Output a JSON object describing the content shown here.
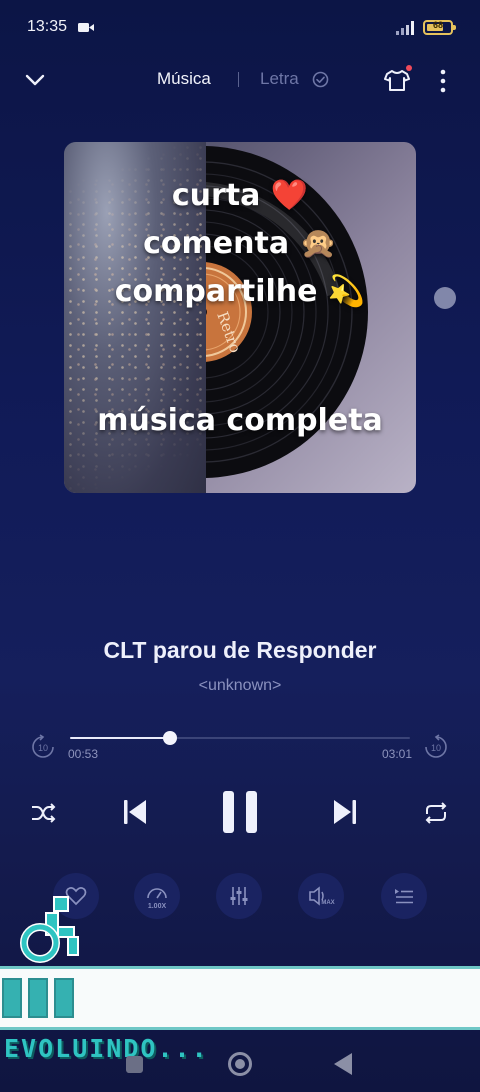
{
  "status_bar": {
    "time": "13:35",
    "battery": "68"
  },
  "nav": {
    "tab_music": "Música",
    "tab_lyrics": "Letra"
  },
  "artwork": {
    "overlay_line1": "curta ❤️",
    "overlay_line2": "comenta 🙊",
    "overlay_line3": "compartilhe 💫",
    "overlay_line4": "música completa",
    "label_text": "Retro"
  },
  "song": {
    "title": "CLT parou de Responder",
    "artist": "<unknown>"
  },
  "progress": {
    "elapsed": "00:53",
    "total": "03:01",
    "fraction": 0.294,
    "skip_seconds": "10"
  },
  "extras": {
    "speed": "1.00X",
    "volume_label": "MAX"
  },
  "watermark": {
    "text": "EVOLUINDO..."
  },
  "colors": {
    "accent": "#e9ebfa",
    "background": "#111b58",
    "watermark": "#2fc4c2",
    "badge": "#f04a5a"
  },
  "icons": {
    "collapse": "chevron-down-icon",
    "verified": "check-circle-icon",
    "theme": "tshirt-icon",
    "more": "more-vertical-icon",
    "rewind": "replay-10-icon",
    "forward": "forward-10-icon",
    "shuffle": "shuffle-icon",
    "previous": "skip-previous-icon",
    "pause": "pause-icon",
    "next": "skip-next-icon",
    "repeat": "repeat-icon",
    "favorite": "heart-icon",
    "speed": "speedometer-icon",
    "equalizer": "equalizer-icon",
    "volume": "volume-max-icon",
    "queue": "playlist-icon"
  }
}
